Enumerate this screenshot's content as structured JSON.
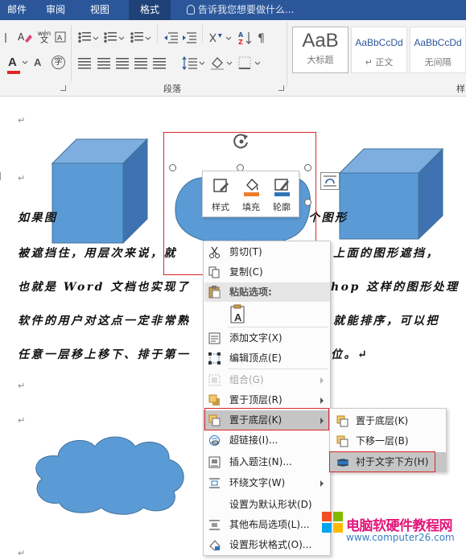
{
  "tabs": [
    {
      "label": "邮件",
      "active": false
    },
    {
      "label": "审阅",
      "active": false
    },
    {
      "label": "视图",
      "active": false
    },
    {
      "label": "格式",
      "active": true
    }
  ],
  "tell_me": "告诉我您想要做什么...",
  "ribbon": {
    "paragraph_group": "段落",
    "styles": [
      {
        "sample": "AaB",
        "name": "大标题"
      },
      {
        "sample": "AaBbCcDd",
        "name": "↵ 正文"
      },
      {
        "sample": "AaBbCcDd",
        "name": "无间隔"
      }
    ],
    "styles_group_partial": "样",
    "font_color_letter": "A",
    "phonetic": "wén",
    "encircle_char": "字"
  },
  "document": {
    "lines": [
      "如果图",
      "被遮挡住，用层次来说，就",
      "也就是 Word 文档也实现了",
      "软件的用户对这点一定非常熟",
      "任意一层移上移下、排于第一"
    ],
    "lines_right": [
      "个图形",
      "上面的图形遮挡，",
      "hop 这样的图形处理",
      "就能排序，可以把",
      "位。↵"
    ],
    "paragraph_mark": "↵"
  },
  "mini_toolbar": {
    "buttons": [
      {
        "label": "样式"
      },
      {
        "label": "填充"
      },
      {
        "label": "轮廓"
      }
    ]
  },
  "context_menu": {
    "items": [
      {
        "label": "剪切(T)",
        "enabled": true,
        "submenu": false
      },
      {
        "label": "复制(C)",
        "enabled": true,
        "submenu": false
      },
      {
        "label": "粘贴选项:",
        "enabled": true,
        "submenu": false,
        "header": true
      },
      {
        "label": "添加文字(X)",
        "enabled": true,
        "submenu": false
      },
      {
        "label": "编辑顶点(E)",
        "enabled": true,
        "submenu": false
      },
      {
        "label": "组合(G)",
        "enabled": false,
        "submenu": true
      },
      {
        "label": "置于顶层(R)",
        "enabled": true,
        "submenu": true
      },
      {
        "label": "置于底层(K)",
        "enabled": true,
        "submenu": true,
        "hover": true
      },
      {
        "label": "超链接(I)...",
        "enabled": true,
        "submenu": false
      },
      {
        "label": "插入题注(N)...",
        "enabled": true,
        "submenu": false
      },
      {
        "label": "环绕文字(W)",
        "enabled": true,
        "submenu": true
      },
      {
        "label": "设置为默认形状(D)",
        "enabled": true,
        "submenu": false
      },
      {
        "label": "其他布局选项(L)...",
        "enabled": true,
        "submenu": false
      },
      {
        "label": "设置形状格式(O)...",
        "enabled": true,
        "submenu": false
      }
    ],
    "paste_letter": "A"
  },
  "submenu": {
    "items": [
      {
        "label": "置于底层(K)"
      },
      {
        "label": "下移一层(B)"
      },
      {
        "label": "衬于文字下方(H)",
        "hover": true
      }
    ]
  },
  "watermark": {
    "title": "电脑软硬件教程网",
    "url": "www.computer26.com"
  },
  "colors": {
    "tab_bar": "#2b579a",
    "shape_blue": "#5b9bd5",
    "highlight_red": "#d7282b",
    "font_color_red": "#e32222",
    "fill_orange": "#ed7d31",
    "outline_blue": "#2e75b6"
  }
}
